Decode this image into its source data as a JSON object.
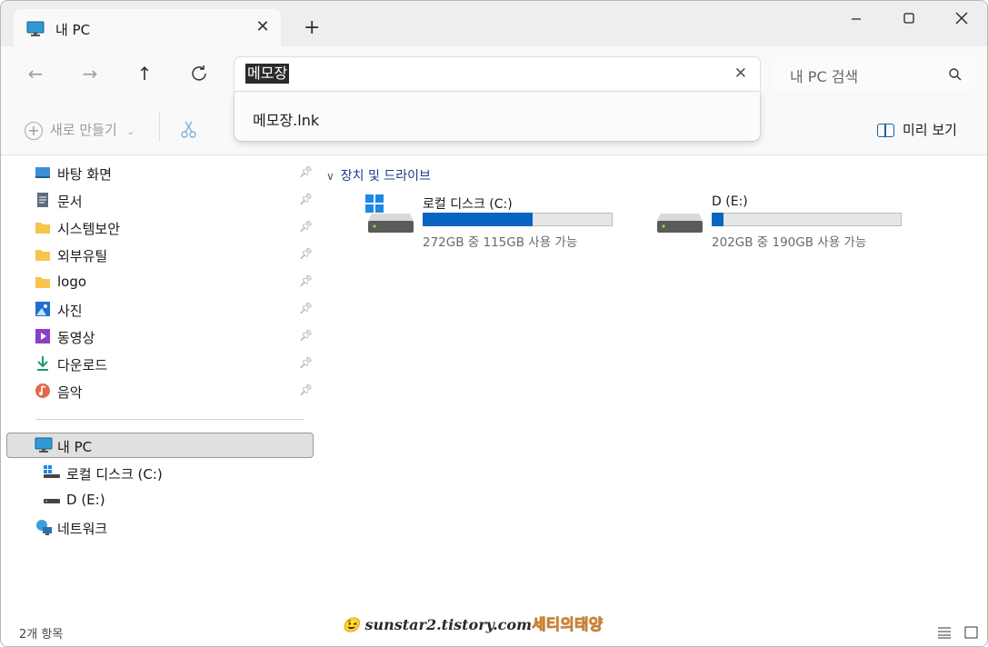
{
  "tab": {
    "title": "내 PC",
    "close_icon": "close-icon",
    "new_tab_icon": "plus-icon"
  },
  "window_controls": {
    "minimize": "minimize-icon",
    "maximize": "maximize-icon",
    "close": "close-icon"
  },
  "nav": {
    "back": "arrow-left-icon",
    "forward": "arrow-right-icon",
    "up": "arrow-up-icon",
    "refresh": "refresh-icon"
  },
  "address": {
    "value": "메모장"
  },
  "search": {
    "placeholder": "내 PC 검색"
  },
  "suggestion": {
    "item": "메모장.lnk"
  },
  "commandbar": {
    "new_label": "새로 만들기",
    "preview_label": "미리 보기"
  },
  "sidebar": {
    "quick_access": [
      {
        "label": "바탕 화면",
        "icon": "desktop-icon"
      },
      {
        "label": "문서",
        "icon": "document-icon"
      },
      {
        "label": "시스템보안",
        "icon": "folder-icon"
      },
      {
        "label": "외부유틸",
        "icon": "folder-icon"
      },
      {
        "label": "logo",
        "icon": "folder-icon"
      },
      {
        "label": "사진",
        "icon": "pictures-icon"
      },
      {
        "label": "동영상",
        "icon": "videos-icon"
      },
      {
        "label": "다운로드",
        "icon": "download-icon"
      },
      {
        "label": "음악",
        "icon": "music-icon"
      }
    ],
    "this_pc": "내 PC",
    "drives": [
      {
        "label": "로컬 디스크 (C:)"
      },
      {
        "label": "D (E:)"
      }
    ],
    "network": "네트워크"
  },
  "main": {
    "group_header": "장치 및 드라이브",
    "drives": [
      {
        "name": "로컬 디스크 (C:)",
        "info": "272GB 중 115GB 사용 가능",
        "used_fraction": 0.577
      },
      {
        "name": "D (E:)",
        "info": "202GB 중 190GB 사용 가능",
        "used_fraction": 0.06
      }
    ]
  },
  "status": {
    "count": "2개 항목"
  },
  "watermark": {
    "url": "sunstar2.tistory.com",
    "name": "세티의태양"
  },
  "colors": {
    "accent": "#0a64c2",
    "folder": "#f6c54a",
    "selection": "#e0e0e0"
  }
}
